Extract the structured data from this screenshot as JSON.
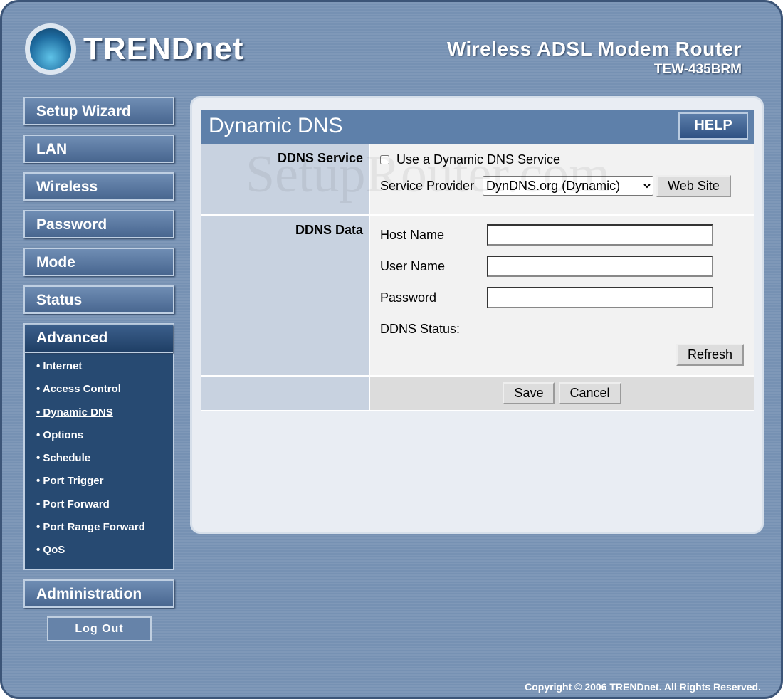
{
  "header": {
    "logo": "TRENDnet",
    "product": "Wireless ADSL Modem Router",
    "model": "TEW-435BRM"
  },
  "nav": {
    "items": [
      "Setup Wizard",
      "LAN",
      "Wireless",
      "Password",
      "Mode",
      "Status"
    ],
    "advanced": {
      "label": "Advanced",
      "items": [
        "Internet",
        "Access Control",
        "Dynamic DNS",
        "Options",
        "Schedule",
        "Port Trigger",
        "Port Forward",
        "Port Range Forward",
        "QoS"
      ],
      "current": "Dynamic DNS"
    },
    "administration": "Administration",
    "logout": "Log Out"
  },
  "page": {
    "title": "Dynamic DNS",
    "help": "HELP",
    "watermark": "SetupRouter.com",
    "ddns_service": {
      "label": "DDNS Service",
      "checkbox_label": "Use a Dynamic DNS Service",
      "checked": false,
      "provider_label": "Service Provider",
      "provider_value": "DynDNS.org (Dynamic)",
      "website_button": "Web Site"
    },
    "ddns_data": {
      "label": "DDNS Data",
      "host_label": "Host Name",
      "host_value": "",
      "user_label": "User Name",
      "user_value": "",
      "password_label": "Password",
      "password_value": "",
      "status_label": "DDNS Status:",
      "refresh_button": "Refresh"
    },
    "save": "Save",
    "cancel": "Cancel"
  },
  "footer": {
    "copyright": "Copyright © 2006 TRENDnet. All Rights Reserved."
  }
}
